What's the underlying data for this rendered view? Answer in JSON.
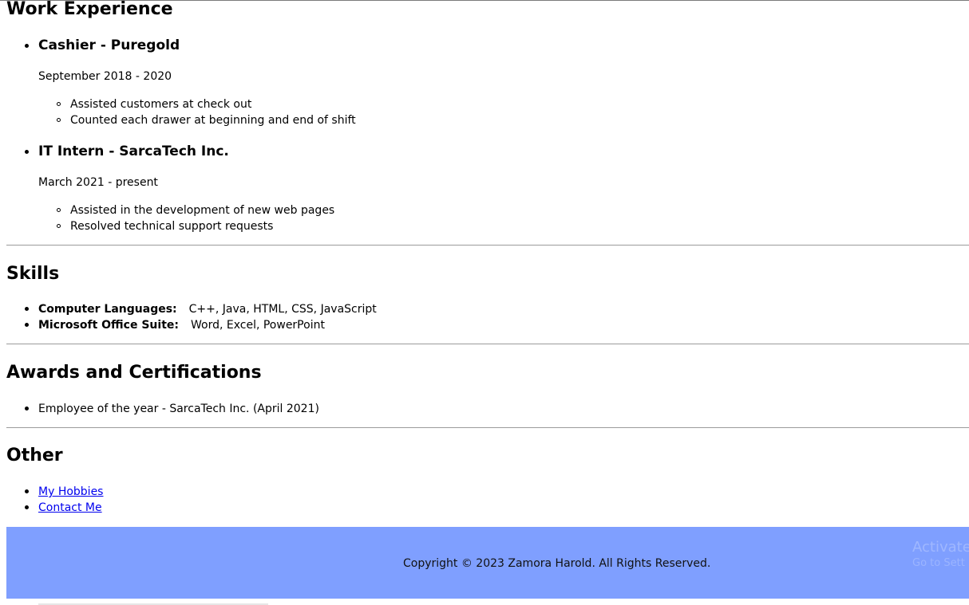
{
  "work_experience": {
    "title": "Work Experience",
    "jobs": [
      {
        "title": "Cashier - Puregold",
        "period": "September 2018 - 2020",
        "duties": [
          "Assisted customers at check out",
          "Counted each drawer at beginning and end of shift"
        ]
      },
      {
        "title": "IT Intern - SarcaTech Inc.",
        "period": "March 2021 - present",
        "duties": [
          "Assisted in the development of new web pages",
          "Resolved technical support requests"
        ]
      }
    ]
  },
  "skills": {
    "title": "Skills",
    "items": [
      {
        "label": "Computer Languages:",
        "value": "C++, Java, HTML, CSS, JavaScript"
      },
      {
        "label": "Microsoft Office Suite:",
        "value": "Word, Excel, PowerPoint"
      }
    ]
  },
  "awards": {
    "title": "Awards and Certifications",
    "items": [
      "Employee of the year - SarcaTech Inc. (April 2021)"
    ]
  },
  "other": {
    "title": "Other",
    "links": [
      "My Hobbies",
      "Contact Me"
    ]
  },
  "footer": {
    "copyright": "Copyright © 2023 Zamora Harold. All Rights Reserved.",
    "background_color": "#7f9fff",
    "watermark_line_1": "Activate",
    "watermark_line_2": "Go to Sett"
  },
  "colors": {
    "link": "#0000ee",
    "divider": "#9b9b9b"
  }
}
